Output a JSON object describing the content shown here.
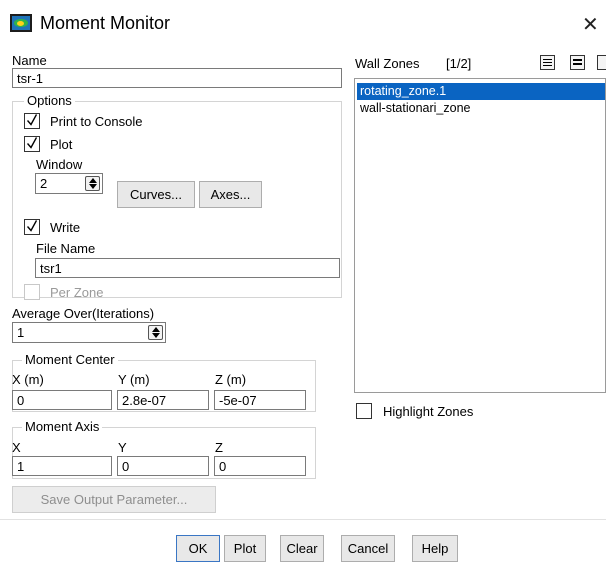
{
  "window": {
    "title": "Moment Monitor"
  },
  "name": {
    "label": "Name",
    "value": "tsr-1"
  },
  "options": {
    "legend": "Options",
    "print_to_console": {
      "label": "Print to Console",
      "checked": true
    },
    "plot": {
      "label": "Plot",
      "checked": true
    },
    "window_label": "Window",
    "window_value": "2",
    "curves_button": "Curves...",
    "axes_button": "Axes...",
    "write": {
      "label": "Write",
      "checked": true
    },
    "file_name_label": "File Name",
    "file_name_value": "tsr1",
    "per_zone": {
      "label": "Per Zone",
      "checked": false,
      "enabled": false
    }
  },
  "average_over": {
    "label": "Average Over(Iterations)",
    "value": "1"
  },
  "moment_center": {
    "legend": "Moment Center",
    "x_label": "X (m)",
    "x_value": "0",
    "y_label": "Y (m)",
    "y_value": "2.8e-07",
    "z_label": "Z (m)",
    "z_value": "-5e-07"
  },
  "moment_axis": {
    "legend": "Moment Axis",
    "x_label": "X",
    "x_value": "1",
    "y_label": "Y",
    "y_value": "0",
    "z_label": "Z",
    "z_value": "0"
  },
  "save_output_button": "Save Output Parameter...",
  "wall_zones": {
    "label": "Wall Zones",
    "count": "[1/2]",
    "items": [
      "rotating_zone.1",
      "wall-stationari_zone"
    ],
    "selected_index": 0
  },
  "highlight_zones": {
    "label": "Highlight Zones",
    "checked": false
  },
  "buttons": {
    "ok": "OK",
    "plot": "Plot",
    "clear": "Clear",
    "cancel": "Cancel",
    "help": "Help"
  },
  "icons": [
    "app-icon",
    "close-icon",
    "check-icon",
    "spinner-icon",
    "select-all-icon",
    "deselect-all-icon"
  ],
  "colors": {
    "selection": "#0a64c2",
    "ok_border": "#3a76c4"
  }
}
